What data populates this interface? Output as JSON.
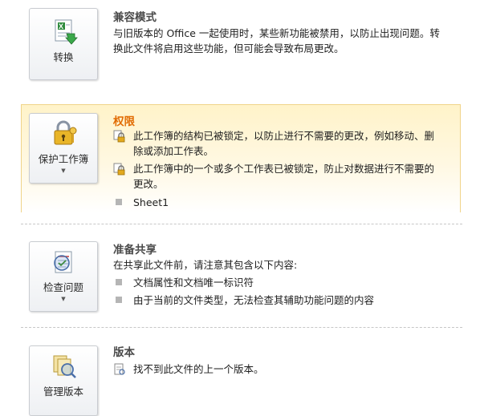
{
  "compat": {
    "button_label": "转换",
    "title": "兼容模式",
    "line1": "与旧版本的 Office 一起使用时，某些新功能被禁用，以防止出现问题。转",
    "line2": "换此文件将启用这些功能，但可能会导致布局更改。"
  },
  "permissions": {
    "button_label": "保护工作簿",
    "title": "权限",
    "items": [
      {
        "line1": "此工作簿的结构已被锁定，以防止进行不需要的更改，例如移动、删",
        "line2": "除或添加工作表。"
      },
      {
        "line1": "此工作簿中的一个或多个工作表已被锁定，防止对数据进行不需要的",
        "line2": "更改。"
      }
    ],
    "sheet": "Sheet1",
    "accent_color": "#e16a00",
    "highlight_color": "#fff3c9"
  },
  "prepare": {
    "button_label": "检查问题",
    "title": "准备共享",
    "intro": "在共享此文件前，请注意其包含以下内容:",
    "items": [
      "文档属性和文档唯一标识符",
      "由于当前的文件类型，无法检查其辅助功能问题的内容"
    ]
  },
  "versions": {
    "button_label": "管理版本",
    "title": "版本",
    "item": "找不到此文件的上一个版本。"
  },
  "icons": {
    "compat": "excel-convert-icon",
    "permissions": "lock-key-icon",
    "prepare": "inspect-document-icon",
    "versions": "manage-versions-icon",
    "bullet_lock": "lock-bullet-icon",
    "bullet_doc": "document-bullet-icon"
  }
}
